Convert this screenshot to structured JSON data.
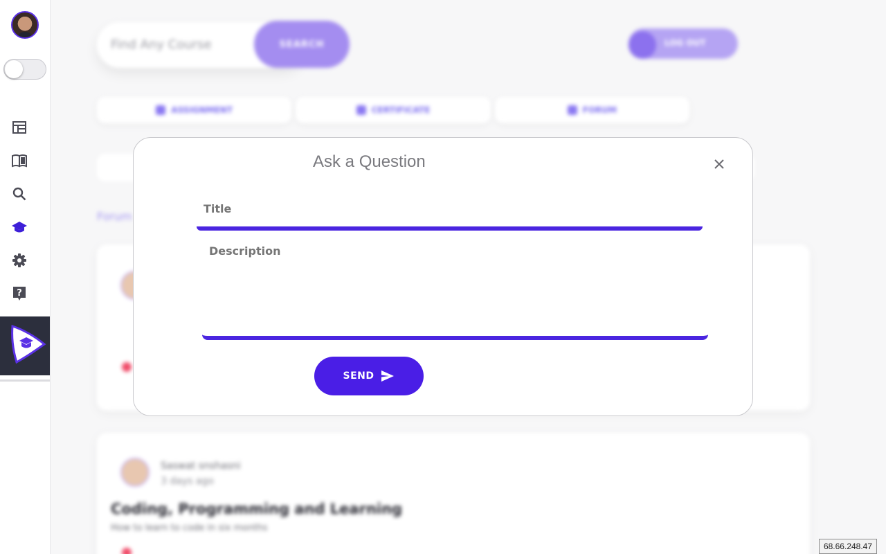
{
  "sidebar": {
    "nav_icons": [
      "dashboard-icon",
      "book-icon",
      "search-icon",
      "school-icon",
      "gear-icon",
      "help-icon"
    ],
    "active_color": "#3d1fd8",
    "logo_tile_color": "#2c2f3d"
  },
  "background": {
    "search_placeholder": "Find Any Course",
    "search_button": "SEARCH",
    "logout_label": "LOG OUT",
    "tabs": [
      {
        "label": "ASSIGNMENT"
      },
      {
        "label": "CERTIFICATE"
      },
      {
        "label": "FORUM"
      }
    ],
    "breadcrumb": "Forum",
    "cards": [
      {
        "author": "",
        "time": "",
        "title": "",
        "description": ""
      },
      {
        "author": "Saswat snshasni",
        "time": "3 days ago",
        "title": "Coding, Programming and Learning",
        "description": "How to learn to code in six months"
      }
    ]
  },
  "modal": {
    "title": "Ask a Question",
    "title_placeholder": "Title",
    "description_placeholder": "Description",
    "send_label": "SEND",
    "accent_color": "#4a25e0"
  },
  "ip_address": "68.66.248.47"
}
